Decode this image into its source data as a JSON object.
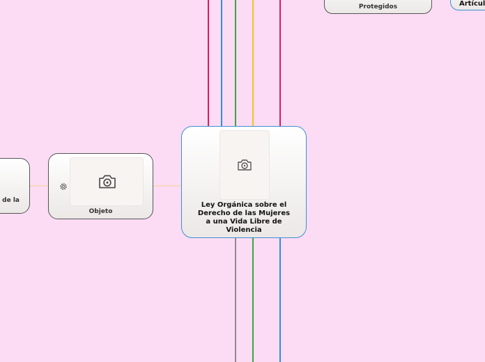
{
  "central": {
    "label": "Ley Orgánica sobre el Derecho de las Mujeres a una Vida Libre de Violencia"
  },
  "objeto": {
    "label": "Objeto"
  },
  "top_node": {
    "label": "Derechos Protegidos",
    "visible_label": "Protegidos"
  },
  "right_node": {
    "label": "Artícul"
  },
  "left_node": {
    "label": "de la"
  },
  "colors": {
    "background": "#fcdcf4",
    "central_border": "#3b8fd4",
    "line_crimson": "#d81b60",
    "line_blue": "#2e8fe0",
    "line_green": "#3ea344",
    "line_yellow": "#f5c518",
    "line_gray": "#8c8c8c",
    "connector": "#f5d08a"
  },
  "icons": {
    "camera": "camera-icon",
    "gear": "gear-icon"
  }
}
